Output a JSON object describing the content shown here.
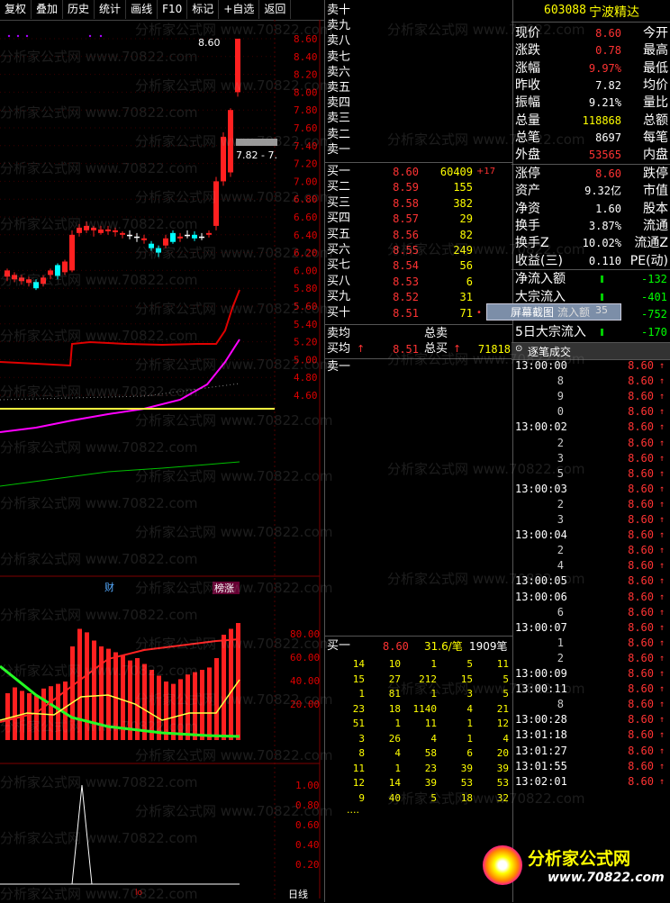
{
  "toolbar": [
    "复权",
    "叠加",
    "历史",
    "统计",
    "画线",
    "F10",
    "标记",
    "+自选",
    "返回"
  ],
  "chart": {
    "price_ticks": [
      "8.60",
      "8.40",
      "8.20",
      "8.00",
      "7.80",
      "7.60",
      "7.40",
      "7.20",
      "7.00",
      "6.80",
      "6.60",
      "6.40",
      "6.20",
      "6.00",
      "5.80",
      "5.60",
      "5.40",
      "5.20",
      "5.00",
      "4.80",
      "4.60"
    ],
    "high_label": "8.60",
    "box_label": "7.82 - 7.",
    "badge_cai": "财",
    "badge_bang": "榜涨",
    "vol_ticks": [
      "80.00",
      "60.00",
      "40.00",
      "20.00"
    ],
    "ind_ticks": [
      "1.00",
      "0.80",
      "0.60",
      "0.40",
      "0.20"
    ],
    "bottom_label": "日线",
    "bottom_small": "lo"
  },
  "book": {
    "sell": [
      "卖十",
      "卖九",
      "卖八",
      "卖七",
      "卖六",
      "卖五",
      "卖四",
      "卖三",
      "卖二",
      "卖一"
    ],
    "buy": [
      {
        "l": "买一",
        "p": "8.60",
        "v": "60409",
        "c": "+17"
      },
      {
        "l": "买二",
        "p": "8.59",
        "v": "155",
        "c": ""
      },
      {
        "l": "买三",
        "p": "8.58",
        "v": "382",
        "c": ""
      },
      {
        "l": "买四",
        "p": "8.57",
        "v": "29",
        "c": ""
      },
      {
        "l": "买五",
        "p": "8.56",
        "v": "82",
        "c": ""
      },
      {
        "l": "买六",
        "p": "8.55",
        "v": "249",
        "c": ""
      },
      {
        "l": "买七",
        "p": "8.54",
        "v": "56",
        "c": ""
      },
      {
        "l": "买八",
        "p": "8.53",
        "v": "6",
        "c": ""
      },
      {
        "l": "买九",
        "p": "8.52",
        "v": "31",
        "c": ""
      },
      {
        "l": "买十",
        "p": "8.51",
        "v": "71",
        "c": "•"
      }
    ],
    "avg_sell": "卖均",
    "avg_buy": "买均",
    "avg_buy_price": "8.51",
    "total_sell": "总卖",
    "total_buy": "总买",
    "total_buy_vol": "71818",
    "sell1_queue_label": "卖一",
    "buy1_queue_label": "买一",
    "buy1_price": "8.60",
    "buy1_avg": "31.6/笔",
    "buy1_count": "1909笔",
    "queue": [
      [
        "14",
        "10",
        "1",
        "5",
        "11"
      ],
      [
        "15",
        "27",
        "212",
        "15",
        "5"
      ],
      [
        "1",
        "81",
        "1",
        "3",
        "5"
      ],
      [
        "23",
        "18",
        "1140",
        "4",
        "21"
      ],
      [
        "51",
        "1",
        "11",
        "1",
        "12"
      ],
      [
        "3",
        "26",
        "4",
        "1",
        "4"
      ],
      [
        "8",
        "4",
        "58",
        "6",
        "20"
      ],
      [
        "11",
        "1",
        "23",
        "39",
        "39"
      ],
      [
        "12",
        "14",
        "39",
        "53",
        "53"
      ],
      [
        "9",
        "40",
        "5",
        "18",
        "32"
      ]
    ],
    "queue_more": "...."
  },
  "quote": {
    "code": "603088",
    "name": "宁波精达",
    "rows": [
      {
        "l": "现价",
        "v": "8.60",
        "r": "今开",
        "c": "#f33"
      },
      {
        "l": "涨跌",
        "v": "0.78",
        "r": "最高",
        "c": "#f33"
      },
      {
        "l": "涨幅",
        "v": "9.97%",
        "r": "最低",
        "c": "#f33"
      },
      {
        "l": "昨收",
        "v": "7.82",
        "r": "均价",
        "c": "#fff"
      },
      {
        "l": "振幅",
        "v": "9.21%",
        "r": "量比",
        "c": "#fff"
      },
      {
        "l": "总量",
        "v": "118868",
        "r": "总额",
        "c": "#ff0"
      },
      {
        "l": "总笔",
        "v": "8697",
        "r": "每笔",
        "c": "#fff"
      },
      {
        "l": "外盘",
        "v": "53565",
        "r": "内盘",
        "c": "#f33"
      }
    ],
    "rows2": [
      {
        "l": "涨停",
        "v": "8.60",
        "r": "跌停",
        "c": "#f33"
      },
      {
        "l": "资产",
        "v": "9.32亿",
        "r": "市值",
        "c": "#fff"
      },
      {
        "l": "净资",
        "v": "1.60",
        "r": "股本",
        "c": "#fff"
      },
      {
        "l": "换手",
        "v": "3.87%",
        "r": "流通",
        "c": "#fff"
      },
      {
        "l": "换手Z",
        "v": "10.02%",
        "r": "流通Z",
        "c": "#fff"
      },
      {
        "l": "收益(三)",
        "v": "0.110",
        "r": "PE(动)",
        "c": "#fff"
      }
    ],
    "flow": [
      {
        "l": "净流入额",
        "v": "-132"
      },
      {
        "l": "大宗流入",
        "v": "-401"
      },
      {
        "l": "屏幕截图",
        "v": "-752"
      },
      {
        "l": "5日大宗流入",
        "v": "-170"
      }
    ],
    "flow_overlay": "屏幕截图",
    "flow_overlay_tail": "流入额",
    "flow_overlay_num": "35",
    "ticks_title": "逐笔成交",
    "ticks": [
      {
        "t": "13:00:00",
        "s": "",
        "p": "8.60"
      },
      {
        "t": "",
        "s": "8",
        "p": "8.60"
      },
      {
        "t": "",
        "s": "9",
        "p": "8.60"
      },
      {
        "t": "",
        "s": "0",
        "p": "8.60"
      },
      {
        "t": "13:00:02",
        "s": "",
        "p": "8.60"
      },
      {
        "t": "",
        "s": "2",
        "p": "8.60"
      },
      {
        "t": "",
        "s": "3",
        "p": "8.60"
      },
      {
        "t": "",
        "s": "5",
        "p": "8.60"
      },
      {
        "t": "13:00:03",
        "s": "",
        "p": "8.60"
      },
      {
        "t": "",
        "s": "2",
        "p": "8.60"
      },
      {
        "t": "",
        "s": "3",
        "p": "8.60"
      },
      {
        "t": "13:00:04",
        "s": "",
        "p": "8.60"
      },
      {
        "t": "",
        "s": "2",
        "p": "8.60"
      },
      {
        "t": "",
        "s": "4",
        "p": "8.60"
      },
      {
        "t": "13:00:05",
        "s": "",
        "p": "8.60"
      },
      {
        "t": "13:00:06",
        "s": "",
        "p": "8.60"
      },
      {
        "t": "",
        "s": "6",
        "p": "8.60"
      },
      {
        "t": "13:00:07",
        "s": "",
        "p": "8.60"
      },
      {
        "t": "",
        "s": "1",
        "p": "8.60"
      },
      {
        "t": "",
        "s": "2",
        "p": "8.60"
      },
      {
        "t": "13:00:09",
        "s": "",
        "p": "8.60"
      },
      {
        "t": "13:00:11",
        "s": "",
        "p": "8.60"
      },
      {
        "t": "",
        "s": "8",
        "p": "8.60"
      },
      {
        "t": "13:00:28",
        "s": "",
        "p": "8.60"
      },
      {
        "t": "13:01:18",
        "s": "",
        "p": "8.60"
      },
      {
        "t": "13:01:27",
        "s": "",
        "p": "8.60"
      },
      {
        "t": "13:01:55",
        "s": "",
        "p": "8.60"
      },
      {
        "t": "13:02:01",
        "s": "",
        "p": "8.60"
      }
    ],
    "logo_text": "分析家公式网",
    "logo_url": "www.70822.com"
  },
  "watermark": "分析家公式网 www.70822.com",
  "colors": {
    "up": "#ff2020",
    "down": "#00ffff",
    "ma_red": "#e00000",
    "ma_mag": "#ff00ff",
    "ma_yel": "#ffff40",
    "ma_grn": "#00c000"
  }
}
